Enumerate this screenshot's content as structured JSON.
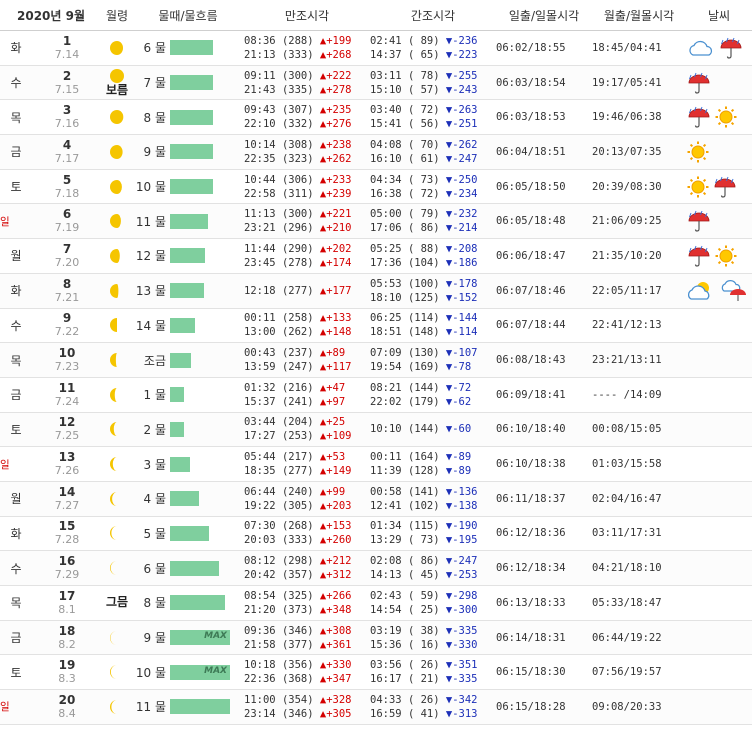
{
  "header": {
    "date_label": "2020년  9월",
    "moon": "월령",
    "tide": "물때/물흐름",
    "high": "만조시각",
    "low": "간조시각",
    "sun": "일출/일몰시각",
    "moonrs": "월출/월몰시각",
    "weather": "날씨"
  },
  "colors": {
    "up": "#d40000",
    "down": "#1c2fb8",
    "bar": "#7fcf9e",
    "sunday": "#d40000",
    "moon": "#f5c500"
  },
  "rows": [
    {
      "dow": "화",
      "sun_day": false,
      "day": "1",
      "lunar": "7.14",
      "moon_label": "",
      "phase": 0.93,
      "tide": "6 물",
      "flow": 0.62,
      "max": "",
      "high": [
        {
          "t": "08:36",
          "h": "(288)",
          "d": "+199"
        },
        {
          "t": "21:13",
          "h": "(333)",
          "d": "+268"
        }
      ],
      "low": [
        {
          "t": "02:41",
          "h": "( 89)",
          "d": "-236"
        },
        {
          "t": "14:37",
          "h": "( 65)",
          "d": "-223"
        }
      ],
      "sunrs": "06:02/18:55",
      "moonrs": "18:45/04:41",
      "wx": [
        "cloud-icon",
        "rain-icon"
      ]
    },
    {
      "dow": "수",
      "sun_day": false,
      "day": "2",
      "lunar": "7.15",
      "moon_label": "보름",
      "phase": 1.0,
      "tide": "7 물",
      "flow": 0.62,
      "max": "",
      "high": [
        {
          "t": "09:11",
          "h": "(300)",
          "d": "+222"
        },
        {
          "t": "21:43",
          "h": "(335)",
          "d": "+278"
        }
      ],
      "low": [
        {
          "t": "03:11",
          "h": "( 78)",
          "d": "-255"
        },
        {
          "t": "15:10",
          "h": "( 57)",
          "d": "-243"
        }
      ],
      "sunrs": "06:03/18:54",
      "moonrs": "19:17/05:41",
      "wx": [
        "rain-icon"
      ]
    },
    {
      "dow": "목",
      "sun_day": false,
      "day": "3",
      "lunar": "7.16",
      "moon_label": "",
      "phase": 0.95,
      "tide": "8 물",
      "flow": 0.62,
      "max": "",
      "high": [
        {
          "t": "09:43",
          "h": "(307)",
          "d": "+235"
        },
        {
          "t": "22:10",
          "h": "(332)",
          "d": "+276"
        }
      ],
      "low": [
        {
          "t": "03:40",
          "h": "( 72)",
          "d": "-263"
        },
        {
          "t": "15:41",
          "h": "( 56)",
          "d": "-251"
        }
      ],
      "sunrs": "06:03/18:53",
      "moonrs": "19:46/06:38",
      "wx": [
        "rain-icon",
        "sun-icon"
      ]
    },
    {
      "dow": "금",
      "sun_day": false,
      "day": "4",
      "lunar": "7.17",
      "moon_label": "",
      "phase": 0.9,
      "tide": "9 물",
      "flow": 0.62,
      "max": "",
      "high": [
        {
          "t": "10:14",
          "h": "(308)",
          "d": "+238"
        },
        {
          "t": "22:35",
          "h": "(323)",
          "d": "+262"
        }
      ],
      "low": [
        {
          "t": "04:08",
          "h": "( 70)",
          "d": "-262"
        },
        {
          "t": "16:10",
          "h": "( 61)",
          "d": "-247"
        }
      ],
      "sunrs": "06:04/18:51",
      "moonrs": "20:13/07:35",
      "wx": [
        "sun-icon"
      ]
    },
    {
      "dow": "토",
      "sun_day": false,
      "day": "5",
      "lunar": "7.18",
      "moon_label": "",
      "phase": 0.85,
      "tide": "10 물",
      "flow": 0.62,
      "max": "",
      "high": [
        {
          "t": "10:44",
          "h": "(306)",
          "d": "+233"
        },
        {
          "t": "22:58",
          "h": "(311)",
          "d": "+239"
        }
      ],
      "low": [
        {
          "t": "04:34",
          "h": "( 73)",
          "d": "-250"
        },
        {
          "t": "16:38",
          "h": "( 72)",
          "d": "-234"
        }
      ],
      "sunrs": "06:05/18:50",
      "moonrs": "20:39/08:30",
      "wx": [
        "sun-icon",
        "rain-icon"
      ]
    },
    {
      "dow": "일",
      "sun_day": true,
      "day": "6",
      "lunar": "7.19",
      "moon_label": "",
      "phase": 0.78,
      "tide": "11 물",
      "flow": 0.54,
      "max": "",
      "high": [
        {
          "t": "11:13",
          "h": "(300)",
          "d": "+221"
        },
        {
          "t": "23:21",
          "h": "(296)",
          "d": "+210"
        }
      ],
      "low": [
        {
          "t": "05:00",
          "h": "( 79)",
          "d": "-232"
        },
        {
          "t": "17:06",
          "h": "( 86)",
          "d": "-214"
        }
      ],
      "sunrs": "06:05/18:48",
      "moonrs": "21:06/09:25",
      "wx": [
        "rain-icon"
      ]
    },
    {
      "dow": "월",
      "sun_day": false,
      "day": "7",
      "lunar": "7.20",
      "moon_label": "",
      "phase": 0.7,
      "tide": "12 물",
      "flow": 0.5,
      "max": "",
      "high": [
        {
          "t": "11:44",
          "h": "(290)",
          "d": "+202"
        },
        {
          "t": "23:45",
          "h": "(278)",
          "d": "+174"
        }
      ],
      "low": [
        {
          "t": "05:25",
          "h": "( 88)",
          "d": "-208"
        },
        {
          "t": "17:36",
          "h": "(104)",
          "d": "-186"
        }
      ],
      "sunrs": "06:06/18:47",
      "moonrs": "21:35/10:20",
      "wx": [
        "rain-icon",
        "sun-icon"
      ]
    },
    {
      "dow": "화",
      "sun_day": false,
      "day": "8",
      "lunar": "7.21",
      "moon_label": "",
      "phase": 0.6,
      "tide": "13 물",
      "flow": 0.48,
      "max": "",
      "high": [
        {
          "t": "12:18",
          "h": "(277)",
          "d": "+177"
        }
      ],
      "low": [
        {
          "t": "05:53",
          "h": "(100)",
          "d": "-178"
        },
        {
          "t": "18:10",
          "h": "(125)",
          "d": "-152"
        }
      ],
      "sunrs": "06:07/18:46",
      "moonrs": "22:05/11:17",
      "wx": [
        "sun-cloud-icon",
        "cloud-rain-icon"
      ]
    },
    {
      "dow": "수",
      "sun_day": false,
      "day": "9",
      "lunar": "7.22",
      "moon_label": "",
      "phase": 0.5,
      "tide": "14 물",
      "flow": 0.36,
      "max": "",
      "high": [
        {
          "t": "00:11",
          "h": "(258)",
          "d": "+133"
        },
        {
          "t": "13:00",
          "h": "(262)",
          "d": "+148"
        }
      ],
      "low": [
        {
          "t": "06:25",
          "h": "(114)",
          "d": "-144"
        },
        {
          "t": "18:51",
          "h": "(148)",
          "d": "-114"
        }
      ],
      "sunrs": "06:07/18:44",
      "moonrs": "22:41/12:13",
      "wx": []
    },
    {
      "dow": "목",
      "sun_day": false,
      "day": "10",
      "lunar": "7.23",
      "moon_label": "",
      "phase": 0.42,
      "tide": "조금",
      "flow": 0.3,
      "max": "",
      "high": [
        {
          "t": "00:43",
          "h": "(237)",
          "d": "+89"
        },
        {
          "t": "13:59",
          "h": "(247)",
          "d": "+117"
        }
      ],
      "low": [
        {
          "t": "07:09",
          "h": "(130)",
          "d": "-107"
        },
        {
          "t": "19:54",
          "h": "(169)",
          "d": "-78"
        }
      ],
      "sunrs": "06:08/18:43",
      "moonrs": "23:21/13:11",
      "wx": []
    },
    {
      "dow": "금",
      "sun_day": false,
      "day": "11",
      "lunar": "7.24",
      "moon_label": "",
      "phase": 0.34,
      "tide": "1 물",
      "flow": 0.2,
      "max": "",
      "high": [
        {
          "t": "01:32",
          "h": "(216)",
          "d": "+47"
        },
        {
          "t": "15:37",
          "h": "(241)",
          "d": "+97"
        }
      ],
      "low": [
        {
          "t": "08:21",
          "h": "(144)",
          "d": "-72"
        },
        {
          "t": "22:02",
          "h": "(179)",
          "d": "-62"
        }
      ],
      "sunrs": "06:09/18:41",
      "moonrs": "---- /14:09",
      "wx": []
    },
    {
      "dow": "토",
      "sun_day": false,
      "day": "12",
      "lunar": "7.25",
      "moon_label": "",
      "phase": 0.27,
      "tide": "2 물",
      "flow": 0.2,
      "max": "",
      "high": [
        {
          "t": "03:44",
          "h": "(204)",
          "d": "+25"
        },
        {
          "t": "17:27",
          "h": "(253)",
          "d": "+109"
        }
      ],
      "low": [
        {
          "t": "10:10",
          "h": "(144)",
          "d": "-60"
        }
      ],
      "sunrs": "06:10/18:40",
      "moonrs": "00:08/15:05",
      "wx": []
    },
    {
      "dow": "일",
      "sun_day": true,
      "day": "13",
      "lunar": "7.26",
      "moon_label": "",
      "phase": 0.2,
      "tide": "3 물",
      "flow": 0.28,
      "max": "",
      "high": [
        {
          "t": "05:44",
          "h": "(217)",
          "d": "+53"
        },
        {
          "t": "18:35",
          "h": "(277)",
          "d": "+149"
        }
      ],
      "low": [
        {
          "t": "00:11",
          "h": "(164)",
          "d": "-89"
        },
        {
          "t": "11:39",
          "h": "(128)",
          "d": "-89"
        }
      ],
      "sunrs": "06:10/18:38",
      "moonrs": "01:03/15:58",
      "wx": []
    },
    {
      "dow": "월",
      "sun_day": false,
      "day": "14",
      "lunar": "7.27",
      "moon_label": "",
      "phase": 0.15,
      "tide": "4 물",
      "flow": 0.42,
      "max": "",
      "high": [
        {
          "t": "06:44",
          "h": "(240)",
          "d": "+99"
        },
        {
          "t": "19:22",
          "h": "(305)",
          "d": "+203"
        }
      ],
      "low": [
        {
          "t": "00:58",
          "h": "(141)",
          "d": "-136"
        },
        {
          "t": "12:41",
          "h": "(102)",
          "d": "-138"
        }
      ],
      "sunrs": "06:11/18:37",
      "moonrs": "02:04/16:47",
      "wx": []
    },
    {
      "dow": "화",
      "sun_day": false,
      "day": "15",
      "lunar": "7.28",
      "moon_label": "",
      "phase": 0.1,
      "tide": "5 물",
      "flow": 0.56,
      "max": "",
      "high": [
        {
          "t": "07:30",
          "h": "(268)",
          "d": "+153"
        },
        {
          "t": "20:03",
          "h": "(333)",
          "d": "+260"
        }
      ],
      "low": [
        {
          "t": "01:34",
          "h": "(115)",
          "d": "-190"
        },
        {
          "t": "13:29",
          "h": "( 73)",
          "d": "-195"
        }
      ],
      "sunrs": "06:12/18:36",
      "moonrs": "03:11/17:31",
      "wx": []
    },
    {
      "dow": "수",
      "sun_day": false,
      "day": "16",
      "lunar": "7.29",
      "moon_label": "",
      "phase": 0.05,
      "tide": "6 물",
      "flow": 0.7,
      "max": "",
      "high": [
        {
          "t": "08:12",
          "h": "(298)",
          "d": "+212"
        },
        {
          "t": "20:42",
          "h": "(357)",
          "d": "+312"
        }
      ],
      "low": [
        {
          "t": "02:08",
          "h": "( 86)",
          "d": "-247"
        },
        {
          "t": "14:13",
          "h": "( 45)",
          "d": "-253"
        }
      ],
      "sunrs": "06:12/18:34",
      "moonrs": "04:21/18:10",
      "wx": []
    },
    {
      "dow": "목",
      "sun_day": false,
      "day": "17",
      "lunar": "8.1",
      "moon_label": "그믐",
      "phase": 0.0,
      "tide": "8 물",
      "flow": 0.78,
      "max": "",
      "high": [
        {
          "t": "08:54",
          "h": "(325)",
          "d": "+266"
        },
        {
          "t": "21:20",
          "h": "(373)",
          "d": "+348"
        }
      ],
      "low": [
        {
          "t": "02:43",
          "h": "( 59)",
          "d": "-298"
        },
        {
          "t": "14:54",
          "h": "( 25)",
          "d": "-300"
        }
      ],
      "sunrs": "06:13/18:33",
      "moonrs": "05:33/18:47",
      "wx": []
    },
    {
      "dow": "금",
      "sun_day": false,
      "day": "18",
      "lunar": "8.2",
      "moon_label": "",
      "phase": 0.03,
      "tide": "9 물",
      "flow": 0.85,
      "max": "MAX",
      "high": [
        {
          "t": "09:36",
          "h": "(346)",
          "d": "+308"
        },
        {
          "t": "21:58",
          "h": "(377)",
          "d": "+361"
        }
      ],
      "low": [
        {
          "t": "03:19",
          "h": "( 38)",
          "d": "-335"
        },
        {
          "t": "15:36",
          "h": "( 16)",
          "d": "-330"
        }
      ],
      "sunrs": "06:14/18:31",
      "moonrs": "06:44/19:22",
      "wx": []
    },
    {
      "dow": "토",
      "sun_day": false,
      "day": "19",
      "lunar": "8.3",
      "moon_label": "",
      "phase": 0.06,
      "tide": "10 물",
      "flow": 0.85,
      "max": "MAX",
      "high": [
        {
          "t": "10:18",
          "h": "(356)",
          "d": "+330"
        },
        {
          "t": "22:36",
          "h": "(368)",
          "d": "+347"
        }
      ],
      "low": [
        {
          "t": "03:56",
          "h": "( 26)",
          "d": "-351"
        },
        {
          "t": "16:17",
          "h": "( 21)",
          "d": "-335"
        }
      ],
      "sunrs": "06:15/18:30",
      "moonrs": "07:56/19:57",
      "wx": []
    },
    {
      "dow": "일",
      "sun_day": true,
      "day": "20",
      "lunar": "8.4",
      "moon_label": "",
      "phase": 0.1,
      "tide": "11 물",
      "flow": 0.85,
      "max": "",
      "high": [
        {
          "t": "11:00",
          "h": "(354)",
          "d": "+328"
        },
        {
          "t": "23:14",
          "h": "(346)",
          "d": "+305"
        }
      ],
      "low": [
        {
          "t": "04:33",
          "h": "( 26)",
          "d": "-342"
        },
        {
          "t": "16:59",
          "h": "( 41)",
          "d": "-313"
        }
      ],
      "sunrs": "06:15/18:28",
      "moonrs": "09:08/20:33",
      "wx": []
    }
  ]
}
